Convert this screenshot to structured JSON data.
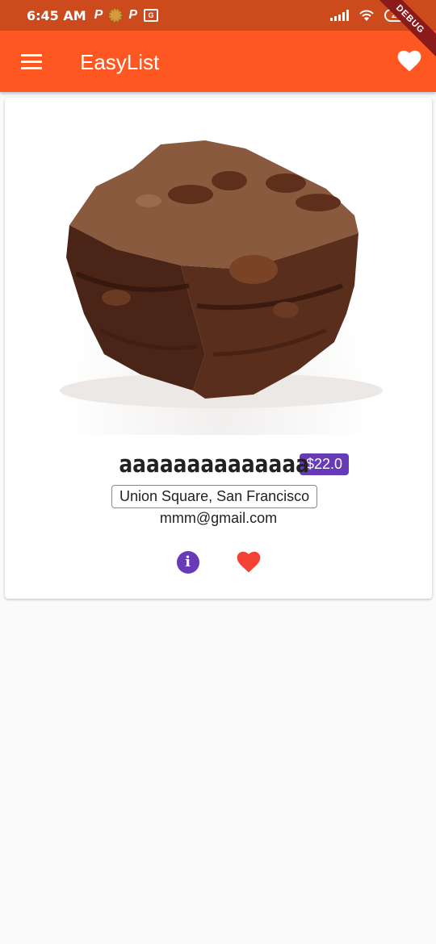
{
  "status_bar": {
    "time": "6:45 AM",
    "notif_p1": "P",
    "notif_p2": "P",
    "notif_translate": "G",
    "battery": "28"
  },
  "debug_banner": "DEBUG",
  "app_bar": {
    "title": "EasyList",
    "menu_icon": "menu-icon",
    "favorite_icon": "heart-icon"
  },
  "product": {
    "title": "aaaaaaaaaaaaaa",
    "price": "$22.0",
    "address": "Union Square, San Francisco",
    "email": "mmm@gmail.com",
    "image_icon": "brownie-image"
  },
  "actions": {
    "info_icon": "info-icon",
    "info_glyph": "i",
    "favorite_icon": "heart-icon"
  },
  "colors": {
    "app_bar": "#ff5722",
    "status_bar": "#cc4a1c",
    "accent": "#673ab7",
    "heart": "#f44336"
  }
}
